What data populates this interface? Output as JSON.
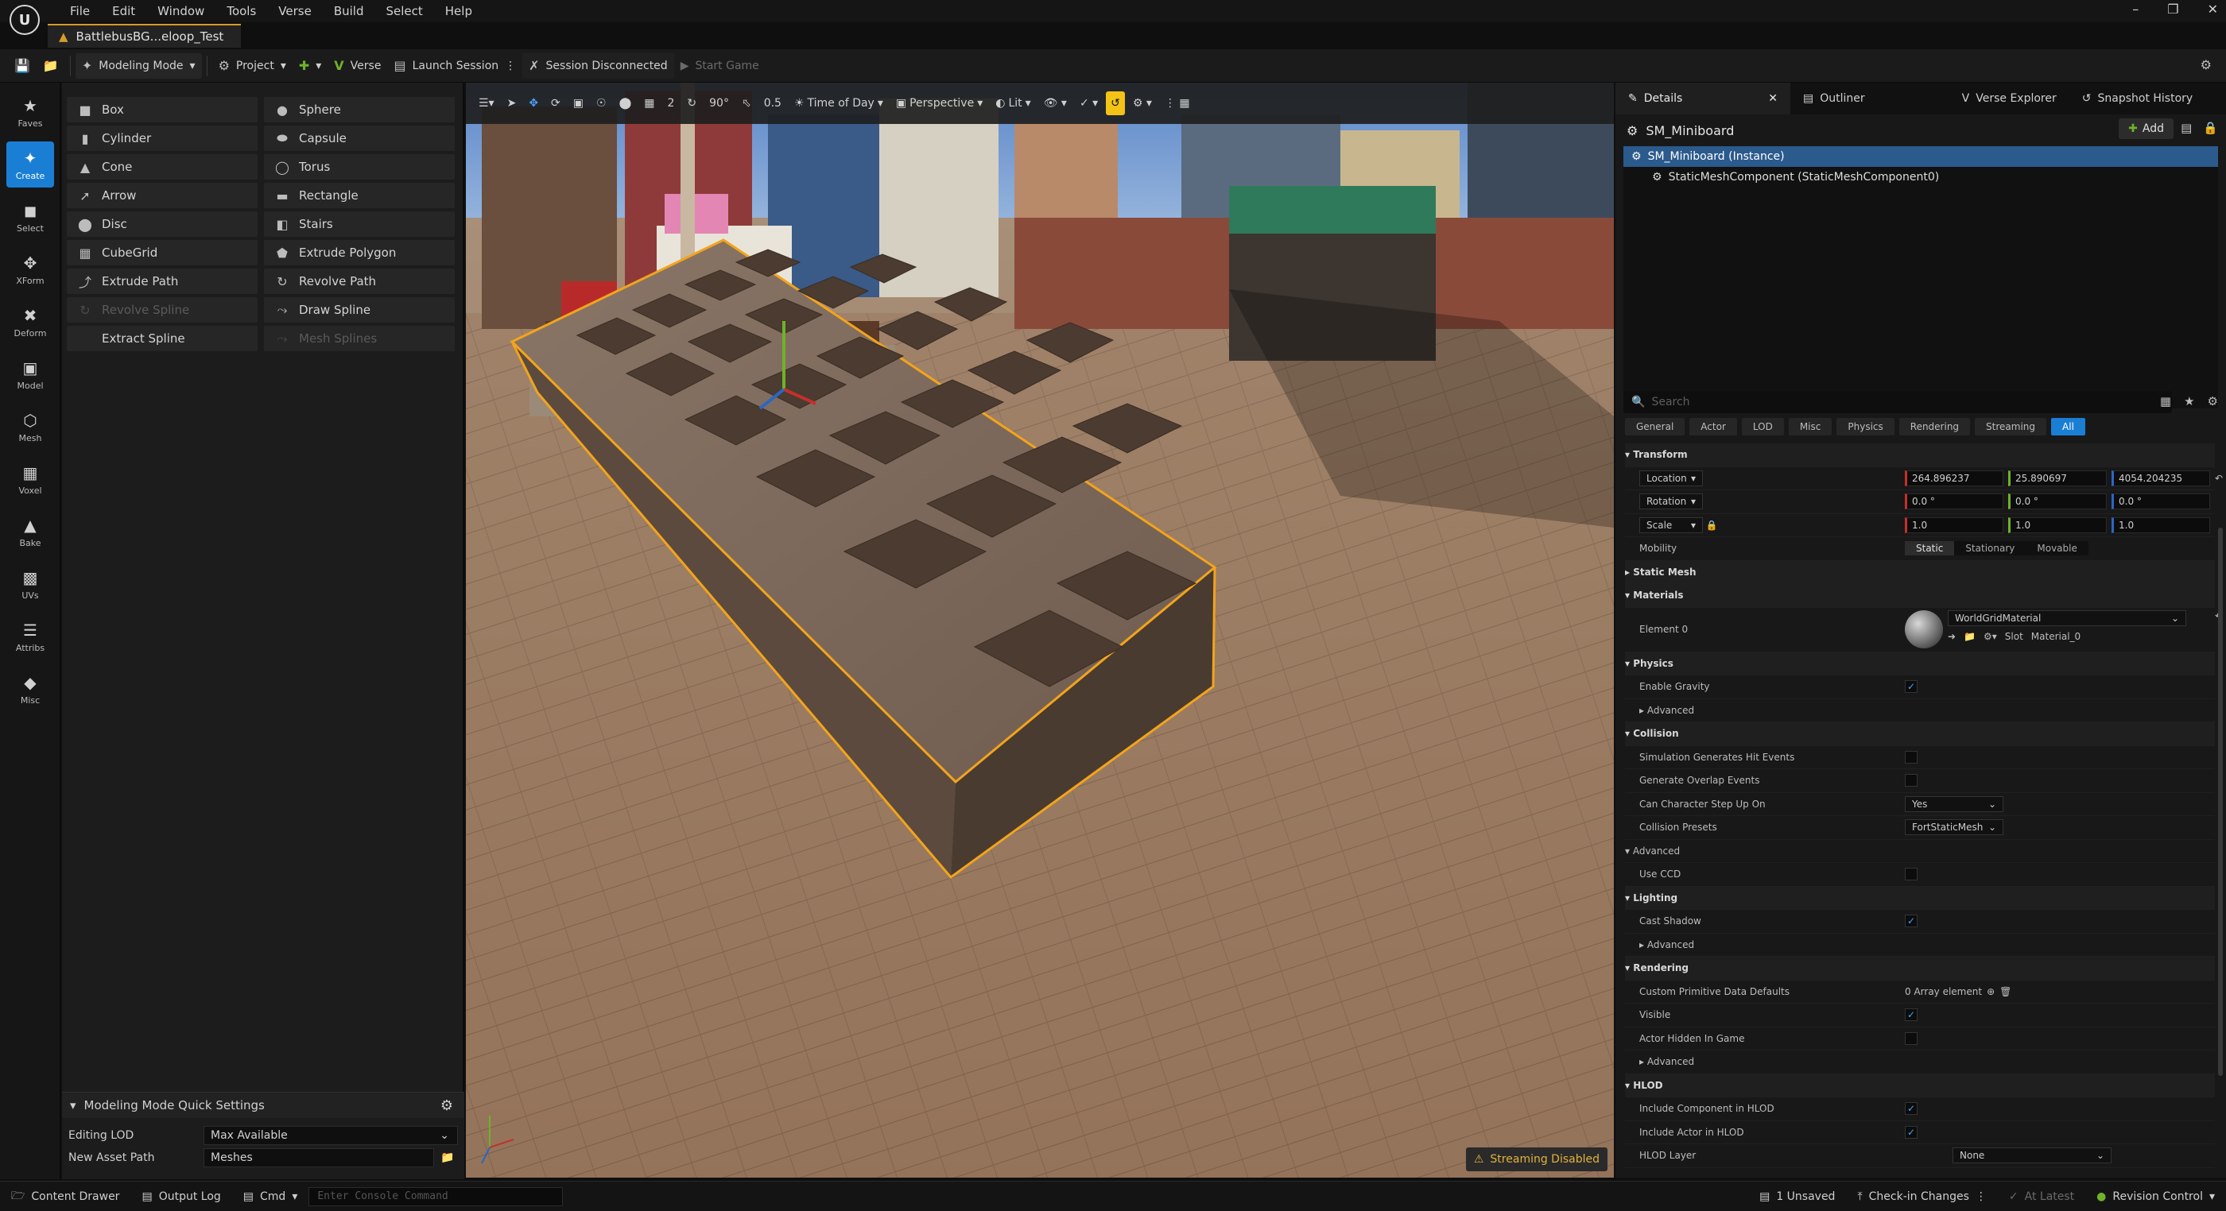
{
  "menu": {
    "items": [
      "File",
      "Edit",
      "Window",
      "Tools",
      "Verse",
      "Build",
      "Select",
      "Help"
    ]
  },
  "project_tab": "BattlebusBG...eloop_Test",
  "toolbar": {
    "modeling_mode": "Modeling Mode",
    "project": "Project",
    "verse": "Verse",
    "launch_session": "Launch Session",
    "session_status": "Session Disconnected",
    "start_game": "Start Game"
  },
  "strip": [
    {
      "label": "Faves",
      "icon": "star-icon"
    },
    {
      "label": "Create",
      "icon": "create-icon",
      "active": true
    },
    {
      "label": "Select",
      "icon": "select-icon"
    },
    {
      "label": "XForm",
      "icon": "xform-icon"
    },
    {
      "label": "Deform",
      "icon": "deform-icon"
    },
    {
      "label": "Model",
      "icon": "model-icon"
    },
    {
      "label": "Mesh",
      "icon": "mesh-icon"
    },
    {
      "label": "Voxel",
      "icon": "voxel-icon"
    },
    {
      "label": "Bake",
      "icon": "bake-icon"
    },
    {
      "label": "UVs",
      "icon": "uvs-icon"
    },
    {
      "label": "Attribs",
      "icon": "attribs-icon"
    },
    {
      "label": "Misc",
      "icon": "misc-icon"
    }
  ],
  "shapes": [
    {
      "label": "Box",
      "icon": "box-icon",
      "enabled": true
    },
    {
      "label": "Sphere",
      "icon": "sphere-icon",
      "enabled": true
    },
    {
      "label": "Cylinder",
      "icon": "cylinder-icon",
      "enabled": true
    },
    {
      "label": "Capsule",
      "icon": "capsule-icon",
      "enabled": true
    },
    {
      "label": "Cone",
      "icon": "cone-icon",
      "enabled": true
    },
    {
      "label": "Torus",
      "icon": "torus-icon",
      "enabled": true
    },
    {
      "label": "Arrow",
      "icon": "arrow-icon",
      "enabled": true
    },
    {
      "label": "Rectangle",
      "icon": "rectangle-icon",
      "enabled": true
    },
    {
      "label": "Disc",
      "icon": "disc-icon",
      "enabled": true
    },
    {
      "label": "Stairs",
      "icon": "stairs-icon",
      "enabled": true
    },
    {
      "label": "CubeGrid",
      "icon": "cubegrid-icon",
      "enabled": true
    },
    {
      "label": "Extrude Polygon",
      "icon": "extrude-polygon-icon",
      "enabled": true
    },
    {
      "label": "Extrude Path",
      "icon": "extrude-path-icon",
      "enabled": true
    },
    {
      "label": "Revolve Path",
      "icon": "revolve-path-icon",
      "enabled": true
    },
    {
      "label": "Revolve Spline",
      "icon": "revolve-spline-icon",
      "enabled": false
    },
    {
      "label": "Draw Spline",
      "icon": "draw-spline-icon",
      "enabled": true
    },
    {
      "label": "Extract Spline",
      "icon": "",
      "enabled": true
    },
    {
      "label": "Mesh Splines",
      "icon": "mesh-splines-icon",
      "enabled": false
    }
  ],
  "quick_settings": {
    "title": "Modeling Mode Quick Settings",
    "editing_lod_label": "Editing LOD",
    "editing_lod_value": "Max Available",
    "asset_path_label": "New Asset Path",
    "asset_path_value": "Meshes"
  },
  "viewport": {
    "speed": "2",
    "angle": "90°",
    "scale": "0.5",
    "time_of_day": "Time of Day",
    "perspective": "Perspective",
    "lit": "Lit",
    "streaming": "Streaming Disabled"
  },
  "details": {
    "tabs": [
      "Details",
      "Outliner",
      "Verse Explorer",
      "Snapshot History"
    ],
    "object_name": "SM_Miniboard",
    "add_label": "Add",
    "instance_label": "SM_Miniboard (Instance)",
    "component_label": "StaticMeshComponent (StaticMeshComponent0)",
    "search_placeholder": "Search",
    "filter_tabs": [
      "General",
      "Actor",
      "LOD",
      "Misc",
      "Physics",
      "Rendering",
      "Streaming",
      "All"
    ],
    "transform": {
      "category": "Transform",
      "location_label": "Location",
      "location": [
        "264.896237",
        "25.890697",
        "4054.204235"
      ],
      "rotation_label": "Rotation",
      "rotation": [
        "0.0 °",
        "0.0 °",
        "0.0 °"
      ],
      "scale_label": "Scale",
      "scale": [
        "1.0",
        "1.0",
        "1.0"
      ],
      "mobility_label": "Mobility",
      "mobility_options": [
        "Static",
        "Stationary",
        "Movable"
      ]
    },
    "static_mesh_category": "Static Mesh",
    "materials": {
      "category": "Materials",
      "element_label": "Element 0",
      "material": "WorldGridMaterial",
      "slot_label": "Slot",
      "slot_value": "Material_0"
    },
    "physics": {
      "category": "Physics",
      "enable_gravity": "Enable Gravity",
      "advanced": "Advanced"
    },
    "collision": {
      "category": "Collision",
      "sim_hit": "Simulation Generates Hit Events",
      "overlap": "Generate Overlap Events",
      "step_up": "Can Character Step Up On",
      "step_up_value": "Yes",
      "presets": "Collision Presets",
      "presets_value": "FortStaticMesh",
      "advanced": "Advanced",
      "use_ccd": "Use CCD"
    },
    "lighting": {
      "category": "Lighting",
      "cast_shadow": "Cast Shadow",
      "advanced": "Advanced"
    },
    "rendering": {
      "category": "Rendering",
      "custom_primitive": "Custom Primitive Data Defaults",
      "custom_primitive_value": "0 Array element",
      "visible": "Visible",
      "hidden_in_game": "Actor Hidden In Game",
      "advanced": "Advanced"
    },
    "hlod": {
      "category": "HLOD",
      "include_component": "Include Component in HLOD",
      "include_actor": "Include Actor in HLOD",
      "hlod_layer": "HLOD Layer",
      "hlod_layer_value": "None"
    }
  },
  "statusbar": {
    "content_drawer": "Content Drawer",
    "output_log": "Output Log",
    "cmd": "Cmd",
    "console_placeholder": "Enter Console Command",
    "unsaved": "1 Unsaved",
    "check_in": "Check-in Changes",
    "at_latest": "At Latest",
    "revision_control": "Revision Control"
  },
  "colors": {
    "accent": "#1a7fd4",
    "selection": "#f3a41b",
    "x_axis": "#c4302b",
    "y_axis": "#6fb22a",
    "z_axis": "#2a67c4"
  }
}
